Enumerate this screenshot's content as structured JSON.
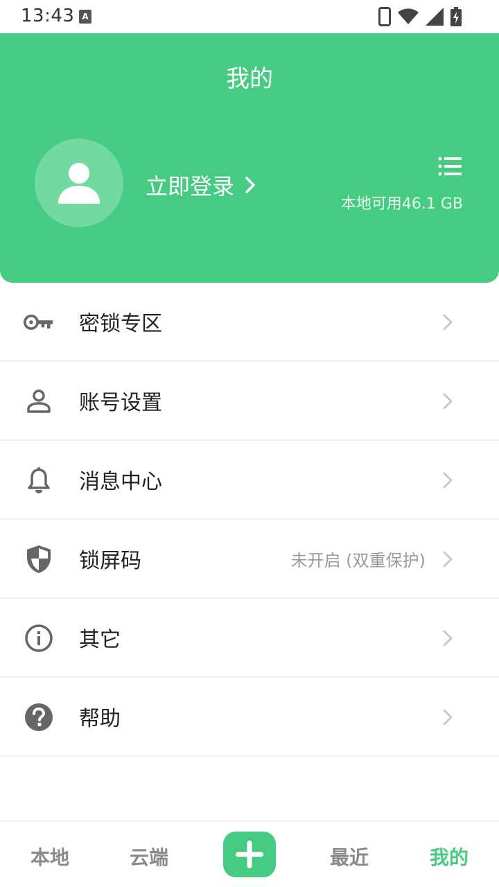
{
  "status_bar": {
    "time": "13:43",
    "notification_letter": "A",
    "icons": [
      "phone-icon",
      "wifi-icon",
      "signal-icon",
      "battery-charging-icon"
    ]
  },
  "header": {
    "title": "我的",
    "login_label": "立即登录",
    "storage_text": "本地可用46.1 GB",
    "background_color": "#45cb82"
  },
  "menu": {
    "items": [
      {
        "label": "密锁专区",
        "icon": "key-icon",
        "value": ""
      },
      {
        "label": "账号设置",
        "icon": "person-icon",
        "value": ""
      },
      {
        "label": "消息中心",
        "icon": "bell-icon",
        "value": ""
      },
      {
        "label": "锁屏码",
        "icon": "shield-icon",
        "value": "未开启 (双重保护)"
      },
      {
        "label": "其它",
        "icon": "info-icon",
        "value": ""
      },
      {
        "label": "帮助",
        "icon": "help-icon",
        "value": ""
      }
    ]
  },
  "bottom_nav": {
    "items": [
      {
        "label": "本地"
      },
      {
        "label": "云端"
      },
      {
        "label": "最近"
      },
      {
        "label": "我的"
      }
    ],
    "active": "我的",
    "accent_color": "#45cb82"
  }
}
